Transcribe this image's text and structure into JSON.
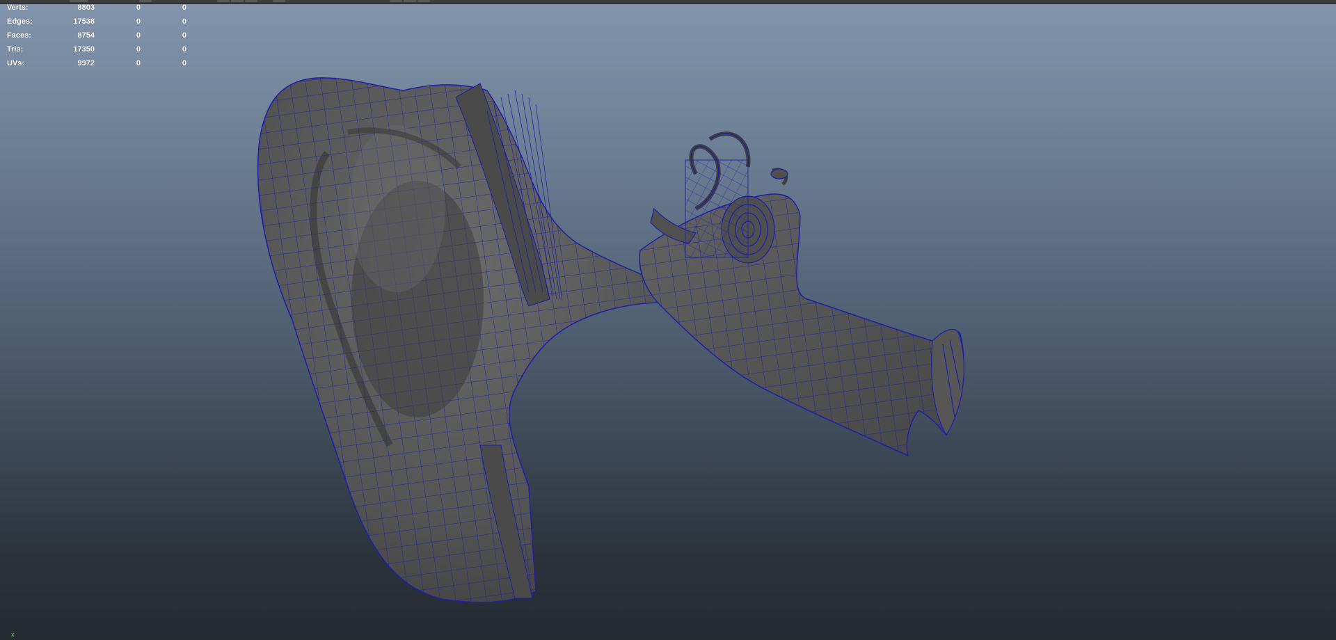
{
  "hud": {
    "rows": [
      {
        "label": "Verts:",
        "v1": "8803",
        "v2": "0",
        "v3": "0"
      },
      {
        "label": "Edges:",
        "v1": "17538",
        "v2": "0",
        "v3": "0"
      },
      {
        "label": "Faces:",
        "v1": "8754",
        "v2": "0",
        "v3": "0"
      },
      {
        "label": "Tris:",
        "v1": "17350",
        "v2": "0",
        "v3": "0"
      },
      {
        "label": "UVs:",
        "v1": "9972",
        "v2": "0",
        "v3": "0"
      }
    ]
  },
  "viewport": {
    "model": "ear-mesh",
    "wire_color": "#1c1fa8",
    "shade_color": "#5a5a5a"
  },
  "axis": {
    "label": "x"
  }
}
